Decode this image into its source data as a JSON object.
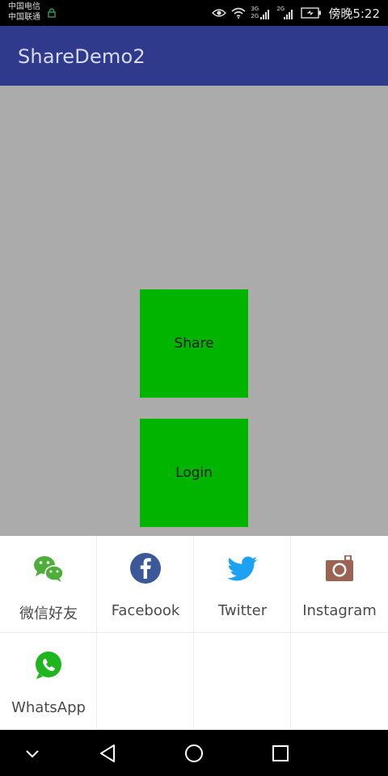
{
  "status_bar": {
    "carrier_1": "中国电信",
    "carrier_2": "中国联通",
    "network_1": "3G",
    "network_1b": "2G",
    "network_2": "2G",
    "time": "傍晚5:22"
  },
  "app_bar": {
    "title": "ShareDemo2"
  },
  "main": {
    "share_button": "Share",
    "login_button": "Login"
  },
  "share_sheet": {
    "items": [
      {
        "label": "微信好友",
        "icon": "wechat-icon",
        "color": "#4fae3a"
      },
      {
        "label": "Facebook",
        "icon": "facebook-icon",
        "color": "#3b5998"
      },
      {
        "label": "Twitter",
        "icon": "twitter-icon",
        "color": "#1da1f2"
      },
      {
        "label": "Instagram",
        "icon": "instagram-icon",
        "color": "#9c6352"
      },
      {
        "label": "WhatsApp",
        "icon": "whatsapp-icon",
        "color": "#1fb51f"
      }
    ]
  },
  "nav_bar": {
    "icons": [
      "chevron-down-icon",
      "back-icon",
      "home-icon",
      "recents-icon"
    ]
  }
}
